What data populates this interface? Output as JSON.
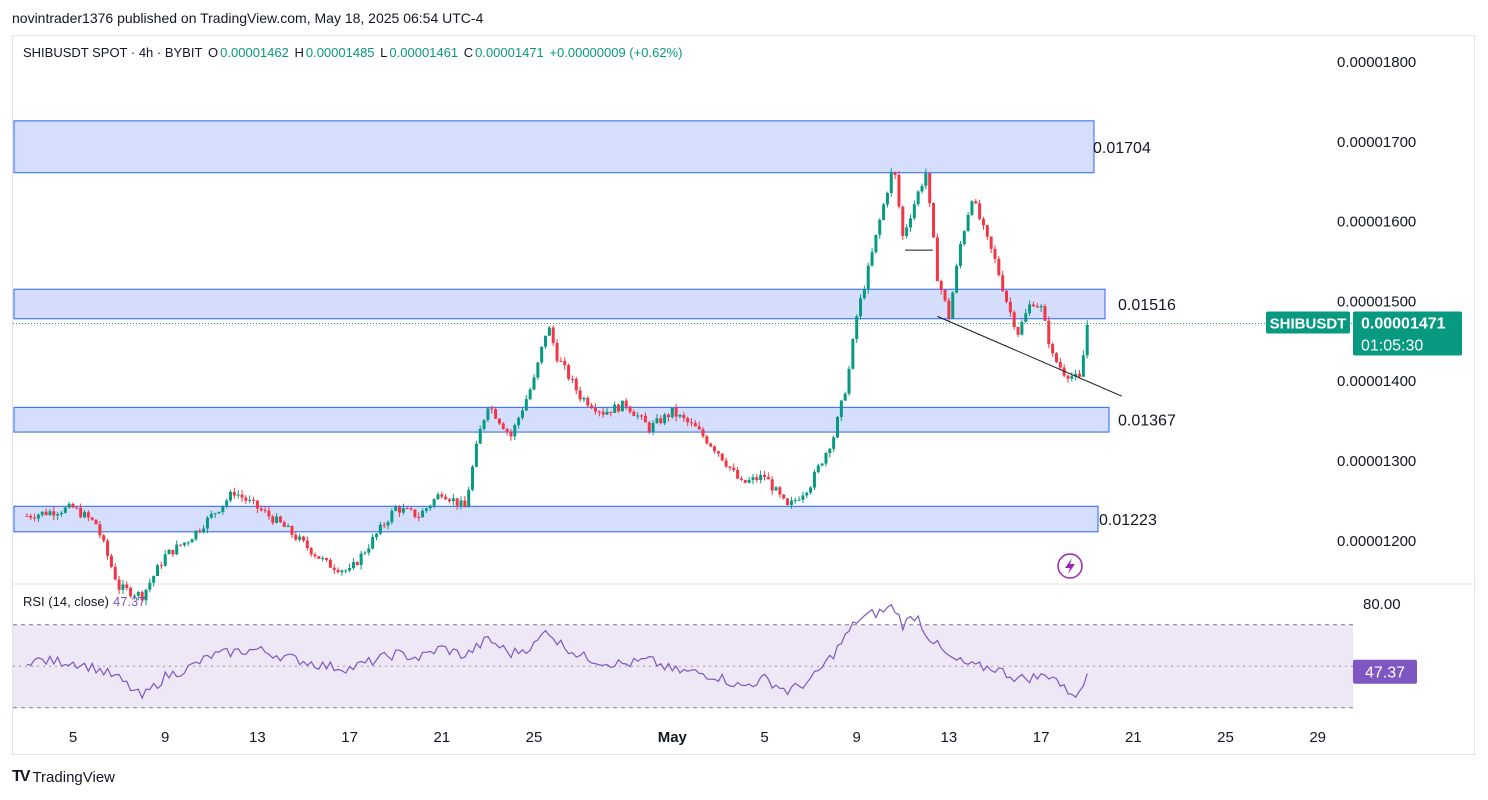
{
  "header": {
    "publisher_text": "novintrader1376 published on TradingView.com, May 18, 2025 06:54 UTC-4"
  },
  "legend": {
    "symbol": "SHIBUSDT SPOT · 4h · BYBIT",
    "o_label": "O",
    "o_value": "0.00001462",
    "h_label": "H",
    "h_value": "0.00001485",
    "l_label": "L",
    "l_value": "0.00001461",
    "c_label": "C",
    "c_value": "0.00001471",
    "change": "+0.00000009 (+0.62%)"
  },
  "rsi": {
    "label": "RSI (14, close)",
    "value": "47.37"
  },
  "price_badge": {
    "symbol": "SHIBUSDT",
    "price": "0.00001471",
    "countdown": "01:05:30",
    "color": "#26a24f"
  },
  "rsi_badge": {
    "value": "47.37",
    "color": "#7e57c2"
  },
  "footer": {
    "brand": "TradingView",
    "logo": "TV"
  },
  "colors": {
    "up": "#089981",
    "down": "#f23645",
    "zone_fill": "#d5defd",
    "zone_border": "#2962ff",
    "rsi_line": "#7e57c2",
    "rsi_band": "#ede7f6"
  },
  "chart_data": [
    {
      "type": "candlestick",
      "title": "SHIBUSDT SPOT · 4h · BYBIT",
      "x_ticks": [
        "5",
        "9",
        "13",
        "17",
        "21",
        "25",
        "May",
        "5",
        "9",
        "13",
        "17",
        "21",
        "25",
        "29"
      ],
      "y_ticks": [
        "0.00001800",
        "0.00001700",
        "0.00001600",
        "0.00001500",
        "0.00001400",
        "0.00001300",
        "0.00001200"
      ],
      "ylim": [
        1.13e-05,
        1.87e-05
      ],
      "last_price": 1.471e-05,
      "zones": [
        {
          "label": "0.01704",
          "low": 1.66e-05,
          "high": 1.725e-05
        },
        {
          "label": "0.01516",
          "low": 1.477e-05,
          "high": 1.514e-05
        },
        {
          "label": "0.01367",
          "low": 1.335e-05,
          "high": 1.366e-05
        },
        {
          "label": "0.01223",
          "low": 1.21e-05,
          "high": 1.242e-05
        }
      ],
      "daily_path": [
        {
          "day": 3,
          "price": 1.23e-05
        },
        {
          "day": 5,
          "price": 1.24e-05
        },
        {
          "day": 6,
          "price": 1.22e-05
        },
        {
          "day": 7,
          "price": 1.14e-05
        },
        {
          "day": 8,
          "price": 1.13e-05
        },
        {
          "day": 9,
          "price": 1.18e-05
        },
        {
          "day": 10,
          "price": 1.2e-05
        },
        {
          "day": 11,
          "price": 1.23e-05
        },
        {
          "day": 12,
          "price": 1.26e-05
        },
        {
          "day": 13,
          "price": 1.24e-05
        },
        {
          "day": 14,
          "price": 1.22e-05
        },
        {
          "day": 16,
          "price": 1.17e-05
        },
        {
          "day": 17,
          "price": 1.16e-05
        },
        {
          "day": 19,
          "price": 1.24e-05
        },
        {
          "day": 20,
          "price": 1.23e-05
        },
        {
          "day": 21,
          "price": 1.26e-05
        },
        {
          "day": 22,
          "price": 1.24e-05
        },
        {
          "day": 22.6,
          "price": 1.33e-05
        },
        {
          "day": 23,
          "price": 1.37e-05
        },
        {
          "day": 24,
          "price": 1.33e-05
        },
        {
          "day": 25,
          "price": 1.4e-05
        },
        {
          "day": 25.6,
          "price": 1.47e-05
        },
        {
          "day": 26,
          "price": 1.43e-05
        },
        {
          "day": 27,
          "price": 1.38e-05
        },
        {
          "day": 28,
          "price": 1.36e-05
        },
        {
          "day": 29,
          "price": 1.37e-05
        },
        {
          "day": 30,
          "price": 1.34e-05
        },
        {
          "day": 31,
          "price": 1.36e-05
        },
        {
          "day": 32,
          "price": 1.34e-05
        },
        {
          "day": 33,
          "price": 1.31e-05
        },
        {
          "day": 34,
          "price": 1.27e-05
        },
        {
          "day": 35,
          "price": 1.28e-05
        },
        {
          "day": 36,
          "price": 1.24e-05
        },
        {
          "day": 37,
          "price": 1.27e-05
        },
        {
          "day": 38,
          "price": 1.33e-05
        },
        {
          "day": 38.6,
          "price": 1.4e-05
        },
        {
          "day": 39,
          "price": 1.48e-05
        },
        {
          "day": 39.6,
          "price": 1.55e-05
        },
        {
          "day": 40,
          "price": 1.6e-05
        },
        {
          "day": 40.6,
          "price": 1.67e-05
        },
        {
          "day": 41,
          "price": 1.58e-05
        },
        {
          "day": 41.6,
          "price": 1.63e-05
        },
        {
          "day": 42,
          "price": 1.66e-05
        },
        {
          "day": 42.5,
          "price": 1.53e-05
        },
        {
          "day": 43,
          "price": 1.48e-05
        },
        {
          "day": 43.5,
          "price": 1.57e-05
        },
        {
          "day": 44,
          "price": 1.63e-05
        },
        {
          "day": 44.6,
          "price": 1.58e-05
        },
        {
          "day": 45,
          "price": 1.55e-05
        },
        {
          "day": 45.6,
          "price": 1.49e-05
        },
        {
          "day": 46,
          "price": 1.46e-05
        },
        {
          "day": 46.6,
          "price": 1.5e-05
        },
        {
          "day": 47,
          "price": 1.49e-05
        },
        {
          "day": 47.5,
          "price": 1.43e-05
        },
        {
          "day": 48,
          "price": 1.41e-05
        },
        {
          "day": 48.7,
          "price": 1.4e-05
        },
        {
          "day": 49,
          "price": 1.47e-05
        }
      ]
    },
    {
      "type": "line",
      "title": "RSI (14, close)",
      "y_ticks": [
        "80.00"
      ],
      "band": [
        30,
        70
      ],
      "ylim": [
        15,
        85
      ],
      "series": [
        {
          "name": "RSI (14, close)",
          "x": [
            3,
            5,
            6,
            7,
            8,
            9,
            10,
            11,
            12,
            13,
            14,
            16,
            17,
            19,
            20,
            21,
            22,
            23,
            24,
            25,
            25.6,
            26,
            27,
            28,
            29,
            30,
            31,
            32,
            33,
            34,
            35,
            36,
            37,
            38,
            39,
            39.6,
            40,
            40.6,
            41,
            41.6,
            42,
            43,
            44,
            45,
            46,
            47,
            47.5,
            48,
            48.7,
            49
          ],
          "values": [
            53,
            52,
            49,
            44,
            35,
            45,
            49,
            55,
            57,
            58,
            55,
            50,
            49,
            56,
            54,
            59,
            55,
            63,
            56,
            60,
            68,
            62,
            55,
            52,
            51,
            53,
            48,
            47,
            45,
            40,
            44,
            38,
            43,
            56,
            72,
            75,
            76,
            79,
            70,
            75,
            66,
            54,
            50,
            49,
            44,
            45,
            46,
            39,
            36,
            47
          ]
        }
      ]
    }
  ]
}
